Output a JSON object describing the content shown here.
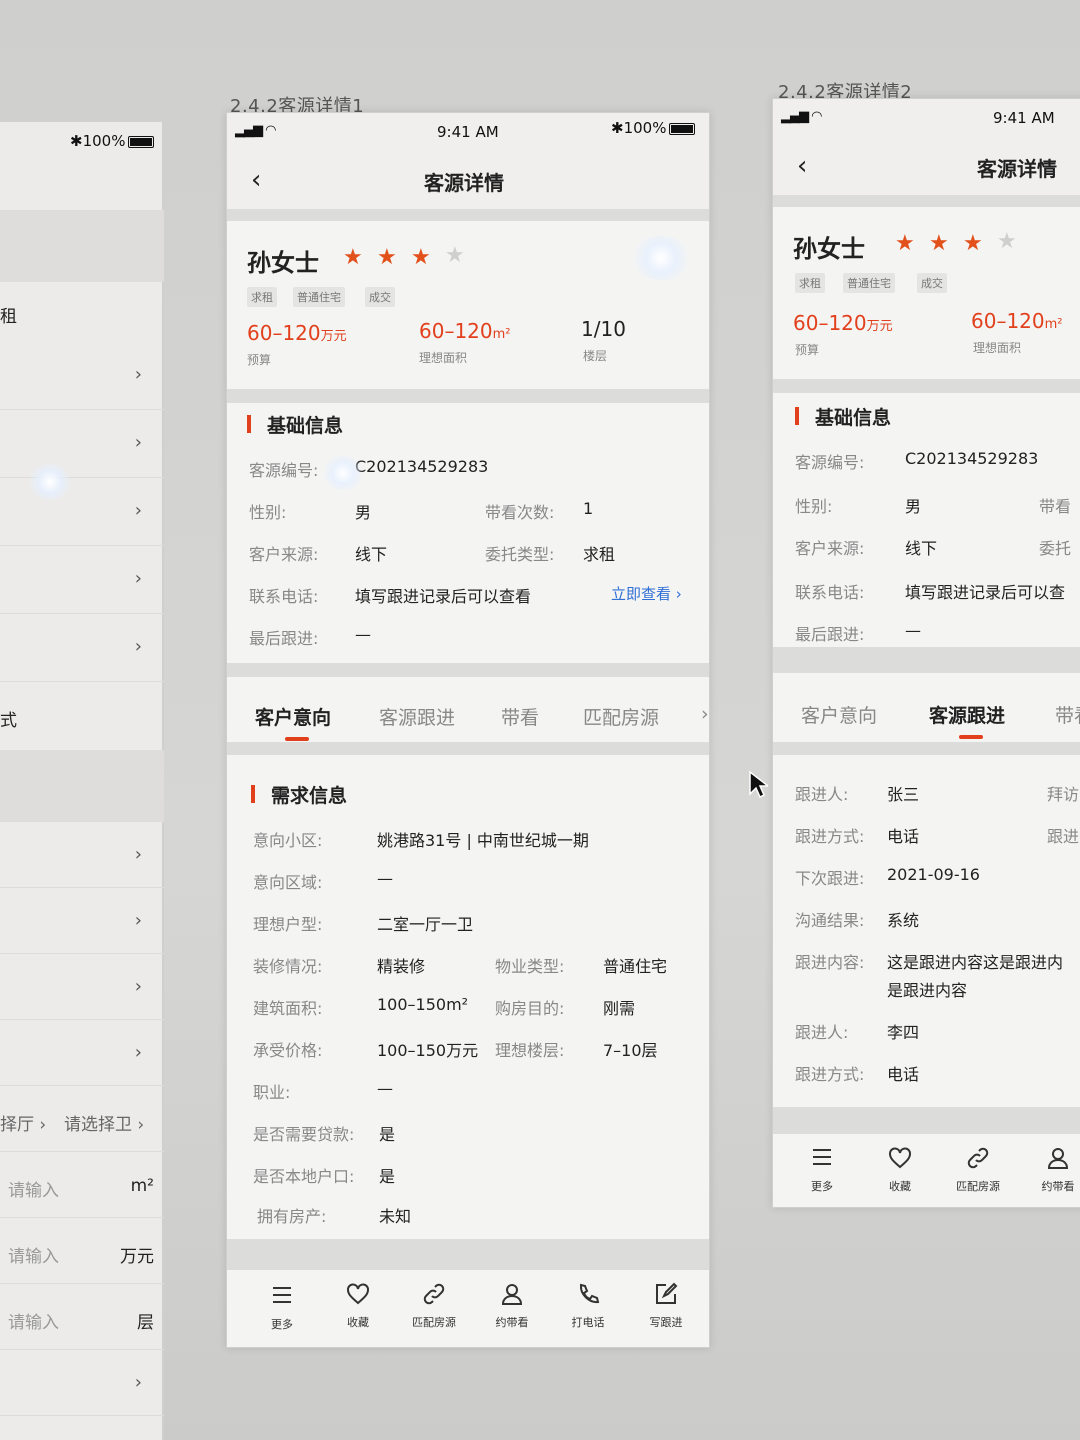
{
  "left_screen": {
    "status": "100%",
    "partial_label_1": "租",
    "partial_label_2": "式",
    "row_chevron": "›",
    "room_select": "择厅 ›",
    "bath_select": "请选择卫 ›",
    "input_area_placeholder": "请输入",
    "input_area_unit": "m²",
    "input_price_placeholder": "请输入",
    "input_price_unit": "万元",
    "input_floor_placeholder": "请输入",
    "input_floor_unit": "层"
  },
  "screen1": {
    "caption": "2.4.2客源详情1",
    "status": {
      "time": "9:41 AM",
      "battery": "100%"
    },
    "nav": {
      "back": "‹",
      "title": "客源详情"
    },
    "customer": {
      "name": "孙女士",
      "rating": 3,
      "rating_max": 4,
      "tags": [
        "求租",
        "普通住宅",
        "成交"
      ]
    },
    "stats": [
      {
        "value": "60–120",
        "unit": "万元",
        "label": "预算"
      },
      {
        "value": "60–120",
        "unit": "m²",
        "label": "理想面积"
      },
      {
        "value": "1/10",
        "unit": "",
        "label": "楼层"
      }
    ],
    "basic": {
      "title": "基础信息",
      "id_label": "客源编号:",
      "id_value": "C202134529283",
      "gender_label": "性别:",
      "gender_value": "男",
      "visits_label": "带看次数:",
      "visits_value": "1",
      "source_label": "客户来源:",
      "source_value": "线下",
      "entrust_label": "委托类型:",
      "entrust_value": "求租",
      "phone_label": "联系电话:",
      "phone_value": "填写跟进记录后可以查看",
      "phone_link": "立即查看 ›",
      "last_label": "最后跟进:",
      "last_value": "—"
    },
    "tabs": [
      "客户意向",
      "客源跟进",
      "带看",
      "匹配房源"
    ],
    "tab_overflow": "›",
    "demand": {
      "title": "需求信息",
      "community_label": "意向小区:",
      "community_value": "姚港路31号 | 中南世纪城一期",
      "area_label": "意向区域:",
      "area_value": "—",
      "layout_label": "理想户型:",
      "layout_value": "二室一厅一卫",
      "deco_label": "装修情况:",
      "deco_value": "精装修",
      "prop_label": "物业类型:",
      "prop_value": "普通住宅",
      "build_label": "建筑面积:",
      "build_value": "100–150m²",
      "purpose_label": "购房目的:",
      "purpose_value": "刚需",
      "price_label": "承受价格:",
      "price_value": "100–150万元",
      "floor_label": "理想楼层:",
      "floor_value": "7–10层",
      "job_label": "职业:",
      "job_value": "—",
      "loan_label": "是否需要贷款:",
      "loan_value": "是",
      "local_label": "是否本地户口:",
      "local_value": "是",
      "house_label": "拥有房产:",
      "house_value": "未知"
    },
    "toolbar": [
      "更多",
      "收藏",
      "匹配房源",
      "约带看",
      "打电话",
      "写跟进"
    ]
  },
  "screen2": {
    "caption": "2.4.2客源详情2",
    "status": {
      "time": "9:41 AM"
    },
    "nav": {
      "back": "‹",
      "title": "客源详情"
    },
    "customer": {
      "name": "孙女士",
      "rating": 3,
      "rating_max": 4,
      "tags": [
        "求租",
        "普通住宅",
        "成交"
      ]
    },
    "stats": [
      {
        "value": "60–120",
        "unit": "万元",
        "label": "预算"
      },
      {
        "value": "60–120",
        "unit": "m²",
        "label": "理想面积"
      }
    ],
    "basic": {
      "title": "基础信息",
      "id_label": "客源编号:",
      "id_value": "C202134529283",
      "gender_label": "性别:",
      "gender_value": "男",
      "visits_label_partial": "带看",
      "source_label": "客户来源:",
      "source_value": "线下",
      "entrust_label_partial": "委托",
      "phone_label": "联系电话:",
      "phone_value": "填写跟进记录后可以查",
      "last_label": "最后跟进:",
      "last_value": "—"
    },
    "tabs": [
      "客户意向",
      "客源跟进",
      "带看"
    ],
    "follow": {
      "person_label": "跟进人:",
      "person_value": "张三",
      "visit_partial": "拜访",
      "method_label": "跟进方式:",
      "method_value": "电话",
      "method_partial": "跟进",
      "next_label": "下次跟进:",
      "next_value": "2021-09-16",
      "result_label": "沟通结果:",
      "result_value": "系统",
      "content_label": "跟进内容:",
      "content_value_1": "这是跟进内容这是跟进内",
      "content_value_2": "是跟进内容",
      "person2_label": "跟进人:",
      "person2_value": "李四",
      "method2_label": "跟进方式:",
      "method2_value": "电话"
    },
    "toolbar": [
      "更多",
      "收藏",
      "匹配房源",
      "约带看"
    ]
  },
  "colors": {
    "accent": "#e2401c",
    "link": "#2f6fd6",
    "background": "#f0efee"
  }
}
